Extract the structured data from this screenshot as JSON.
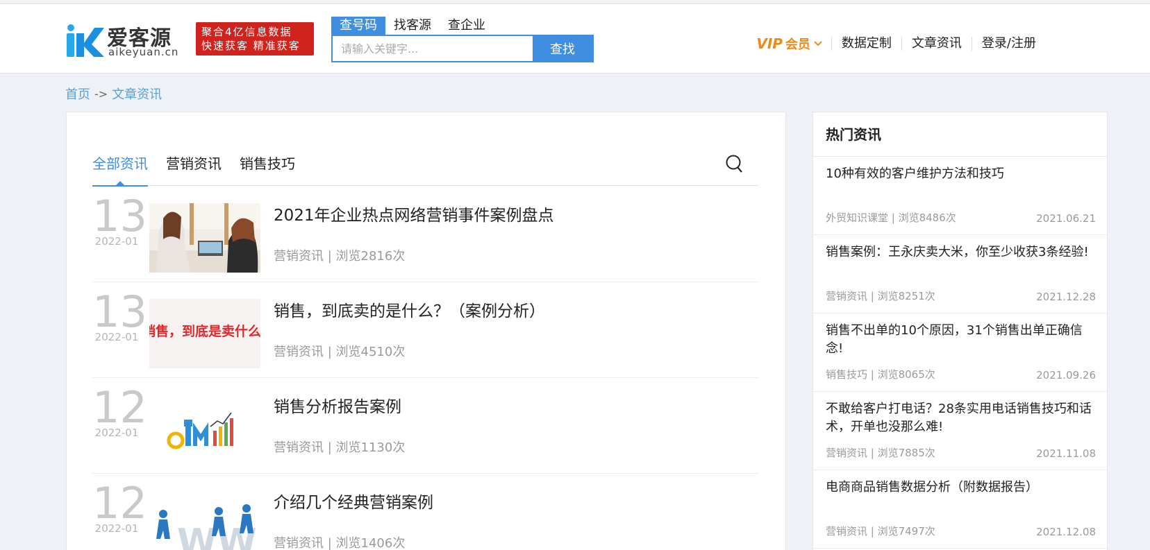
{
  "header": {
    "logo_text": "爱客源",
    "logo_sub": "aikeyuan.cn",
    "promo_line1": "聚合4亿信息数据",
    "promo_line2": "快速获客 精准获客",
    "search_tabs": [
      {
        "label": "查号码",
        "active": true
      },
      {
        "label": "找客源",
        "active": false
      },
      {
        "label": "查企业",
        "active": false
      }
    ],
    "search_placeholder": "请输入关键字...",
    "search_button": "查找",
    "nav": {
      "vip_prefix": "VIP",
      "vip_label": "会员",
      "items": [
        "数据定制",
        "文章资讯",
        "登录/注册"
      ]
    }
  },
  "breadcrumb": {
    "home": "首页",
    "separator": "->",
    "current": "文章资讯"
  },
  "main": {
    "tabs": [
      {
        "label": "全部资讯",
        "active": true
      },
      {
        "label": "营销资讯",
        "active": false
      },
      {
        "label": "销售技巧",
        "active": false
      }
    ],
    "articles": [
      {
        "day": "13",
        "ym": "2022-01",
        "title": "2021年企业热点网络营销事件案例盘点",
        "meta": "营销资讯 | 浏览2816次"
      },
      {
        "day": "13",
        "ym": "2022-01",
        "title": "销售，到底卖的是什么？（案例分析）",
        "meta": "营销资讯 | 浏览4510次",
        "thumb_text": "销售，到底是卖什么？"
      },
      {
        "day": "12",
        "ym": "2022-01",
        "title": "销售分析报告案例",
        "meta": "营销资讯 | 浏览1130次"
      },
      {
        "day": "12",
        "ym": "2022-01",
        "title": "介绍几个经典营销案例",
        "meta": "营销资讯 | 浏览1406次"
      }
    ]
  },
  "sidebar": {
    "title": "热门资讯",
    "items": [
      {
        "title": "10种有效的客户维护方法和技巧",
        "meta": "外贸知识课堂 | 浏览8486次",
        "date": "2021.06.21"
      },
      {
        "title": "销售案例：王永庆卖大米，你至少收获3条经验!",
        "meta": "营销资讯 | 浏览8251次",
        "date": "2021.12.28"
      },
      {
        "title": "销售不出单的10个原因，31个销售出单正确信念!",
        "meta": "销售技巧 | 浏览8065次",
        "date": "2021.09.26"
      },
      {
        "title": "不敢给客户打电话？28条实用电话销售技巧和话术，开单也没那么难!",
        "meta": "营销资讯 | 浏览7885次",
        "date": "2021.11.08"
      },
      {
        "title": "电商商品销售数据分析（附数据报告）",
        "meta": "营销资讯 | 浏览7497次",
        "date": "2021.12.08"
      }
    ]
  },
  "colors": {
    "accent": "#3f8ee0",
    "vip": "#f08a17",
    "promo_red": "#d0231e",
    "muted": "#9a9a9a"
  }
}
